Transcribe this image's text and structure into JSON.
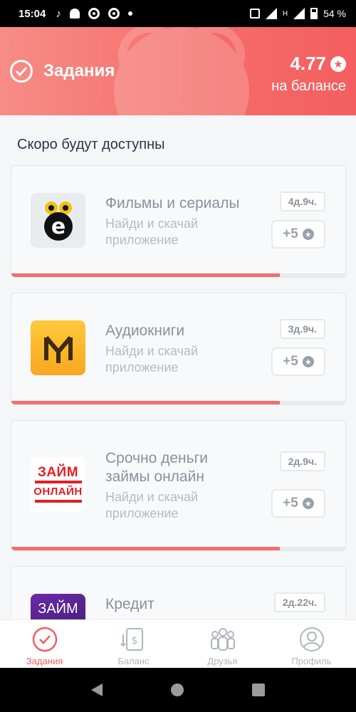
{
  "status_bar": {
    "time": "15:04",
    "battery_percent": "54 %",
    "signal_label": "H"
  },
  "header": {
    "title": "Задания",
    "balance_value": "4.77",
    "balance_label": "на балансе"
  },
  "section": {
    "title": "Скоро будут доступны"
  },
  "tasks": [
    {
      "name_line1": "Фильмы и сериалы",
      "name_line2": "",
      "description_line1": "Найди и скачай",
      "description_line2": "приложение",
      "time_left": "4д.9ч.",
      "reward": "+5",
      "progress": 0.8,
      "icon": "e-owl-app-icon"
    },
    {
      "name_line1": "Аудиокниги",
      "name_line2": "",
      "description_line1": "Найди и скачай",
      "description_line2": "приложение",
      "time_left": "3д.9ч.",
      "reward": "+5",
      "progress": 0.8,
      "icon": "my-books-app-icon"
    },
    {
      "name_line1": "Срочно деньги",
      "name_line2": "займы онлайн",
      "description_line1": "Найди и скачай",
      "description_line2": "приложение",
      "time_left": "2д.9ч.",
      "reward": "+5",
      "progress": 0.8,
      "icon": "zaim-online-app-icon",
      "icon_text_top": "ЗАЙМ",
      "icon_text_bottom": "ОНЛАЙН"
    },
    {
      "name_line1": "Кредит",
      "time_left": "2д.22ч.",
      "icon": "zaim-purple-app-icon",
      "icon_text": "ЗАЙМ"
    }
  ],
  "bottom_nav": [
    {
      "label": "Задания",
      "icon": "check-circle-icon",
      "active": true
    },
    {
      "label": "Баланс",
      "icon": "balance-exchange-icon",
      "active": false
    },
    {
      "label": "Друзья",
      "icon": "friends-icon",
      "active": false
    },
    {
      "label": "Профиль",
      "icon": "profile-icon",
      "active": false
    }
  ],
  "colors": {
    "accent": "#f45e5e",
    "header_gradient_start": "#f78c86",
    "muted_text": "#8a909c"
  }
}
